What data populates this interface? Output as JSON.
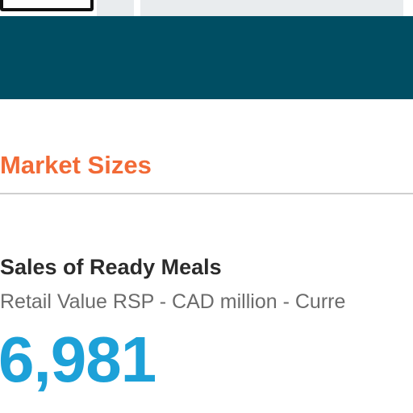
{
  "market_sizes": {
    "section_title": "Market Sizes",
    "metric_title": "Sales of Ready Meals",
    "metric_subtitle": "Retail Value RSP - CAD million - Curre",
    "metric_value": "6,981"
  },
  "colors": {
    "banner": "#004e63",
    "section_title": "#f26a36",
    "metric_value": "#1da1d8"
  }
}
